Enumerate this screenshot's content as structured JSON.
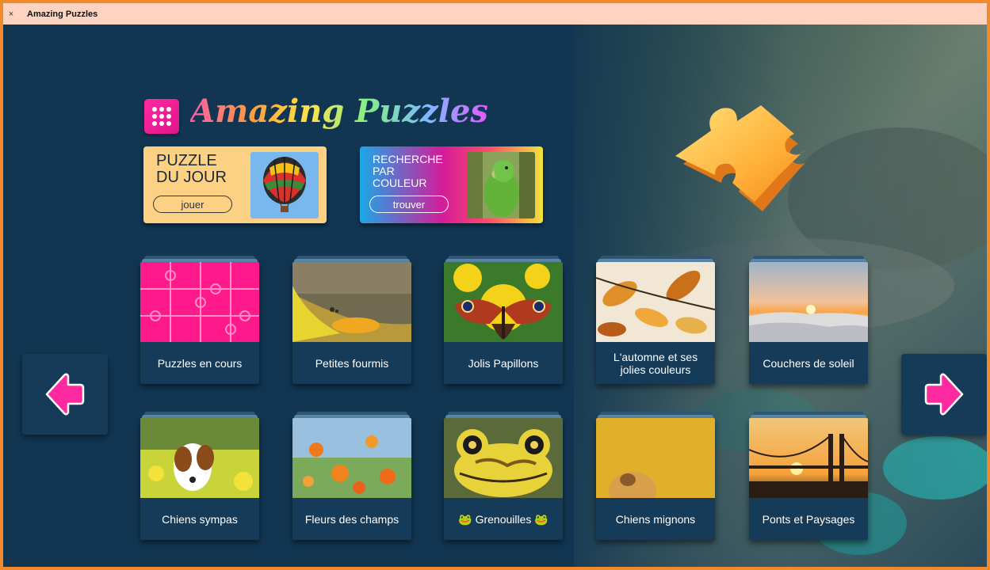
{
  "window": {
    "title": "Amazing Puzzles",
    "close_glyph": "×"
  },
  "header": {
    "logo_text": "Amazing Puzzles",
    "logo_icon": "grid-dots-icon",
    "accent": "#ff2aa0"
  },
  "features": {
    "daily": {
      "title_line1": "PUZZLE",
      "title_line2": "DU JOUR",
      "button": "jouer",
      "thumb": "hot-air-balloon"
    },
    "color": {
      "title_line1": "RECHERCHE",
      "title_line2": "PAR",
      "title_line3": "COULEUR",
      "button": "trouver",
      "thumb": "green-parrot"
    }
  },
  "navigation": {
    "prev_icon": "arrow-left-icon",
    "next_icon": "arrow-right-icon",
    "arrow_color": "#ff2aa0"
  },
  "categories": [
    {
      "label": "Puzzles en cours",
      "thumb": "pink-puzzle-pattern"
    },
    {
      "label": "Petites fourmis",
      "thumb": "ants"
    },
    {
      "label": "Jolis Papillons",
      "thumb": "butterfly"
    },
    {
      "label": "L'automne et ses jolies couleurs",
      "thumb": "autumn-leaves"
    },
    {
      "label": "Couchers de soleil",
      "thumb": "sunset-clouds"
    },
    {
      "label": "Chiens sympas",
      "thumb": "dog-in-flowers"
    },
    {
      "label": "Fleurs des champs",
      "thumb": "orange-flowers"
    },
    {
      "label": "🐸 Grenouilles 🐸",
      "thumb": "frog"
    },
    {
      "label": "Chiens mignons",
      "thumb": "puppy"
    },
    {
      "label": "Ponts et Paysages",
      "thumb": "bridge-sunset"
    }
  ]
}
